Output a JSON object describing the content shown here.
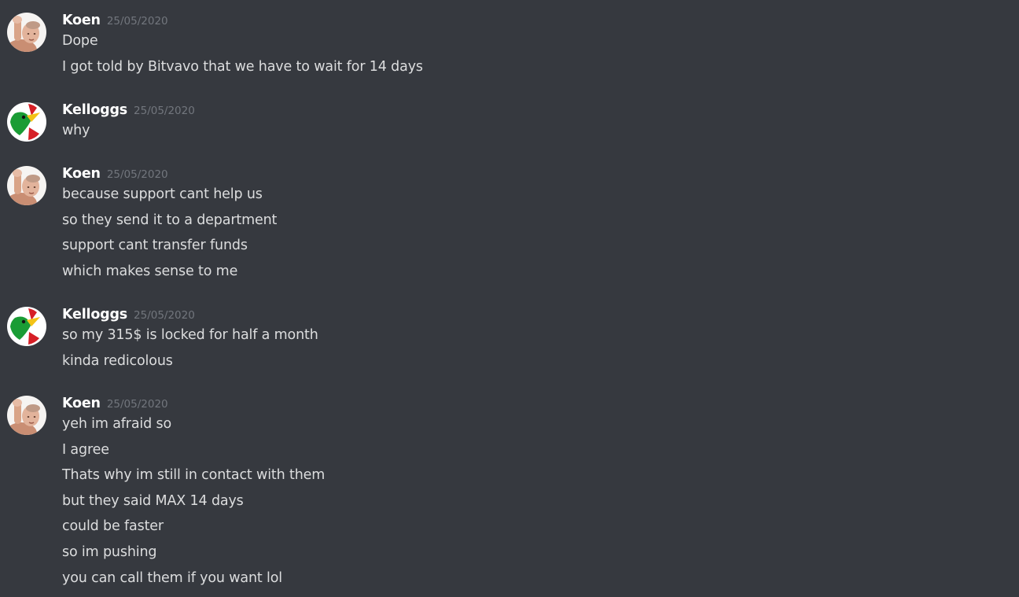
{
  "channel": {
    "groups": [
      {
        "author": "Koen",
        "avatar": "koen-avatar",
        "timestamp": "25/05/2020",
        "lines": [
          "Dope",
          "I got told by Bitvavo that we have to wait for 14 days"
        ]
      },
      {
        "author": "Kelloggs",
        "avatar": "kelloggs-avatar",
        "timestamp": "25/05/2020",
        "lines": [
          "why"
        ]
      },
      {
        "author": "Koen",
        "avatar": "koen-avatar",
        "timestamp": "25/05/2020",
        "lines": [
          "because support cant help us",
          "so they send it to a department",
          "support cant transfer funds",
          "which makes sense to me"
        ]
      },
      {
        "author": "Kelloggs",
        "avatar": "kelloggs-avatar",
        "timestamp": "25/05/2020",
        "lines": [
          "so my 315$ is locked for half a month",
          "kinda redicolous"
        ]
      },
      {
        "author": "Koen",
        "avatar": "koen-avatar",
        "timestamp": "25/05/2020",
        "lines": [
          "yeh im afraid so",
          "I agree",
          "Thats why im still in contact with them",
          "but they said MAX 14 days",
          "could be faster",
          "so im pushing",
          "you can call them if you want lol"
        ]
      }
    ]
  },
  "colors": {
    "background": "#36393f",
    "username": "#ffffff",
    "timestamp": "#72767d",
    "message_text": "#dcddde"
  }
}
